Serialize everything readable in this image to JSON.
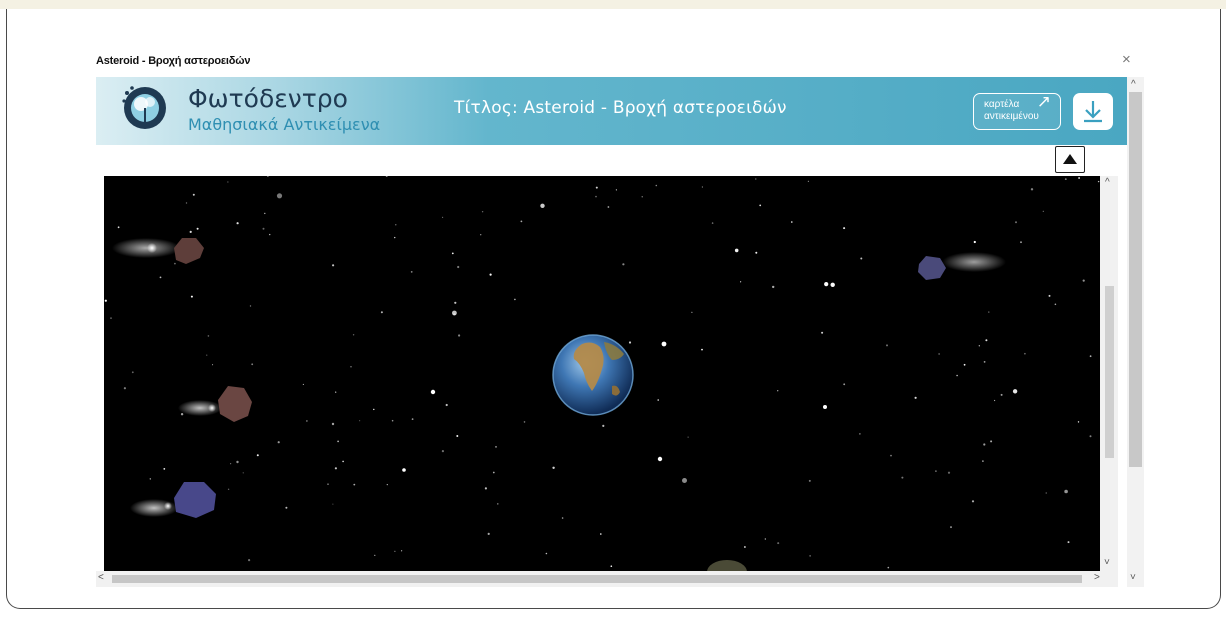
{
  "dialog": {
    "title": "Asteroid - Βροχή αστεροειδών",
    "close_label": "×"
  },
  "banner": {
    "brand_name": "Φωτόδεντρο",
    "brand_subtitle": "Μαθησιακά Αντικείμενα",
    "object_title": "Τίτλος:  Asteroid - Βροχή αστεροειδών",
    "tab_button_line1": "καρτέλα",
    "tab_button_line2": "αντικειμένου",
    "tab_button_arrow": "↗",
    "download_icon": "download-icon"
  },
  "colors": {
    "banner_accent": "#4aa7c2",
    "brand_dark": "#1f3a52",
    "brand_light": "#2f8fb2",
    "space": "#000000"
  },
  "scroll": {
    "up": "^",
    "down": "˅",
    "left": "<",
    "right": ">"
  }
}
